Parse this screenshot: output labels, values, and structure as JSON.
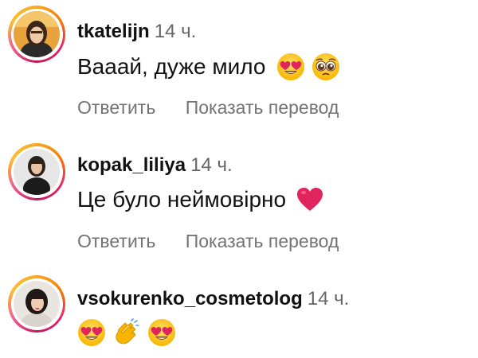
{
  "comments": [
    {
      "username": "tkatelijn",
      "time": "14 ч.",
      "text": "Вааай, дуже мило",
      "emojis": [
        "heart-eyes-emoji",
        "pleading-face-emoji"
      ],
      "reply_label": "Ответить",
      "translate_label": "Показать перевод"
    },
    {
      "username": "kopak_liliya",
      "time": "14 ч.",
      "text": "Це було неймовірно",
      "emojis": [
        "red-heart-emoji"
      ],
      "reply_label": "Ответить",
      "translate_label": "Показать перевод"
    },
    {
      "username": "vsokurenko_cosmetolog",
      "time": "14 ч.",
      "text": "",
      "emojis": [
        "heart-eyes-emoji",
        "clapping-hands-emoji",
        "heart-eyes-emoji"
      ]
    }
  ],
  "colors": {
    "username": "#111111",
    "meta": "#737373",
    "story_ring": [
      "#f9a825",
      "#e91e63",
      "#c2185b"
    ],
    "heart": "#e0245e",
    "emoji_face": "#ffcc33"
  }
}
